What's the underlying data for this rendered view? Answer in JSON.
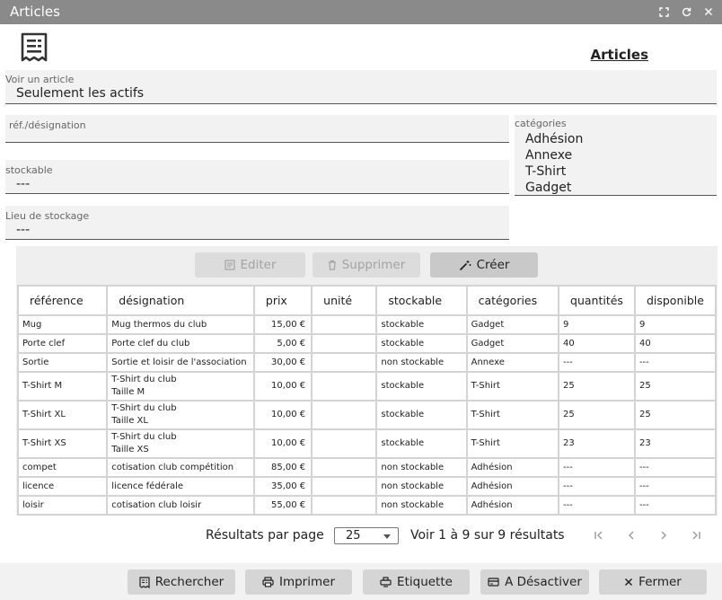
{
  "window": {
    "title": "Articles"
  },
  "header": {
    "title": "Articles"
  },
  "filters": {
    "voir": {
      "label": "Voir un article",
      "value": "Seulement les actifs"
    },
    "ref": {
      "label": "réf./désignation",
      "value": ""
    },
    "stockable": {
      "label": "stockable",
      "value": "---"
    },
    "lieu": {
      "label": "Lieu de stockage",
      "value": "---"
    },
    "categories": {
      "label": "catégories",
      "items": [
        "Adhésion",
        "Annexe",
        "T-Shirt",
        "Gadget"
      ]
    }
  },
  "actions": {
    "edit": "Editer",
    "delete": "Supprimer",
    "create": "Créer"
  },
  "table": {
    "columns": [
      "référence",
      "désignation",
      "prix",
      "unité",
      "stockable",
      "catégories",
      "quantités",
      "disponible"
    ],
    "rows": [
      {
        "ref": "Mug",
        "des1": "Mug thermos du club",
        "des2": "",
        "prix": "15,00 €",
        "unite": "",
        "stockable": "stockable",
        "cat": "Gadget",
        "qte": "9",
        "dispo": "9"
      },
      {
        "ref": "Porte clef",
        "des1": "Porte clef du club",
        "des2": "",
        "prix": "5,00 €",
        "unite": "",
        "stockable": "stockable",
        "cat": "Gadget",
        "qte": "40",
        "dispo": "40"
      },
      {
        "ref": "Sortie",
        "des1": "Sortie et loisir de l'association",
        "des2": "",
        "prix": "30,00 €",
        "unite": "",
        "stockable": "non stockable",
        "cat": "Annexe",
        "qte": "---",
        "dispo": "---"
      },
      {
        "ref": "T-Shirt M",
        "des1": "T-Shirt du club",
        "des2": "Taille M",
        "prix": "10,00 €",
        "unite": "",
        "stockable": "stockable",
        "cat": "T-Shirt",
        "qte": "25",
        "dispo": "25"
      },
      {
        "ref": "T-Shirt XL",
        "des1": "T-Shirt du club",
        "des2": "Taille XL",
        "prix": "10,00 €",
        "unite": "",
        "stockable": "stockable",
        "cat": "T-Shirt",
        "qte": "25",
        "dispo": "25"
      },
      {
        "ref": "T-Shirt XS",
        "des1": "T-Shirt du club",
        "des2": "Taille XS",
        "prix": "10,00 €",
        "unite": "",
        "stockable": "stockable",
        "cat": "T-Shirt",
        "qte": "23",
        "dispo": "23"
      },
      {
        "ref": "compet",
        "des1": "cotisation club compétition",
        "des2": "",
        "prix": "85,00 €",
        "unite": "",
        "stockable": "non stockable",
        "cat": "Adhésion",
        "qte": "---",
        "dispo": "---"
      },
      {
        "ref": "licence",
        "des1": "licence fédérale",
        "des2": "",
        "prix": "35,00 €",
        "unite": "",
        "stockable": "non stockable",
        "cat": "Adhésion",
        "qte": "---",
        "dispo": "---"
      },
      {
        "ref": "loisir",
        "des1": "cotisation club loisir",
        "des2": "",
        "prix": "55,00 €",
        "unite": "",
        "stockable": "non stockable",
        "cat": "Adhésion",
        "qte": "---",
        "dispo": "---"
      }
    ]
  },
  "pager": {
    "per_page_label": "Résultats par page",
    "per_page": "25",
    "info": "Voir 1 à 9 sur 9 résultats"
  },
  "footer": {
    "search": "Rechercher",
    "print": "Imprimer",
    "label": "Etiquette",
    "deactivate": "A Désactiver",
    "close": "Fermer"
  },
  "icons": {
    "maximize": "maximize-icon",
    "refresh": "refresh-icon",
    "close": "close-icon",
    "logo": "receipt-icon",
    "edit": "edit-icon",
    "delete": "trash-icon",
    "create": "magic-wand-icon",
    "search": "receipt-search-icon",
    "print": "printer-icon",
    "label": "label-icon",
    "deactivate": "deactivate-icon",
    "close_footer": "close-icon"
  }
}
